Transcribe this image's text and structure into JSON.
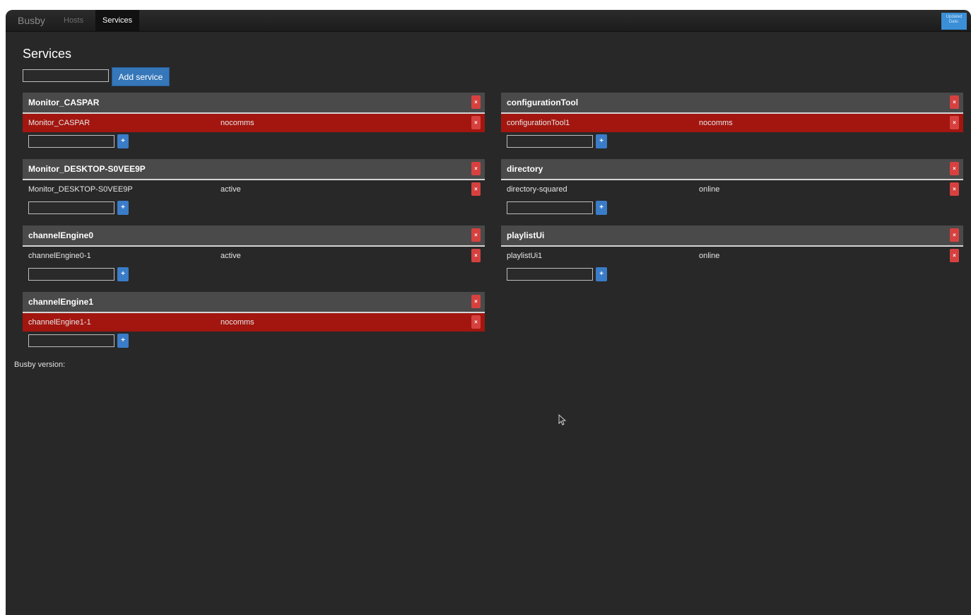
{
  "navbar": {
    "brand": "Busby",
    "tabs": [
      "Hosts",
      "Services"
    ],
    "corner_label": "Updated Date:"
  },
  "page": {
    "title": "Services",
    "add_service_label": "Add service"
  },
  "services": [
    {
      "name": "Monitor_CASPAR",
      "instances": [
        {
          "name": "Monitor_CASPAR",
          "status": "nocomms"
        }
      ]
    },
    {
      "name": "configurationTool",
      "instances": [
        {
          "name": "configurationTool1",
          "status": "nocomms"
        }
      ]
    },
    {
      "name": "Monitor_DESKTOP-S0VEE9P",
      "instances": [
        {
          "name": "Monitor_DESKTOP-S0VEE9P",
          "status": "active"
        }
      ]
    },
    {
      "name": "directory",
      "instances": [
        {
          "name": "directory-squared",
          "status": "online"
        }
      ]
    },
    {
      "name": "channelEngine0",
      "instances": [
        {
          "name": "channelEngine0-1",
          "status": "active"
        }
      ]
    },
    {
      "name": "playlistUi",
      "instances": [
        {
          "name": "playlistUi1",
          "status": "online"
        }
      ]
    },
    {
      "name": "channelEngine1",
      "instances": [
        {
          "name": "channelEngine1-1",
          "status": "nocomms"
        }
      ]
    }
  ],
  "footer": {
    "version_label": "Busby version:"
  },
  "glyphs": {
    "delete": "×",
    "add": "+"
  },
  "colors": {
    "background": "#282828",
    "panel_header": "#4a4a4a",
    "nocomms_row": "#a2160f",
    "delete_button": "#d6413f",
    "add_button": "#3577b9"
  },
  "icons": {
    "delete": "close-icon",
    "add": "plus-icon",
    "pointer": "mouse-pointer-icon"
  }
}
